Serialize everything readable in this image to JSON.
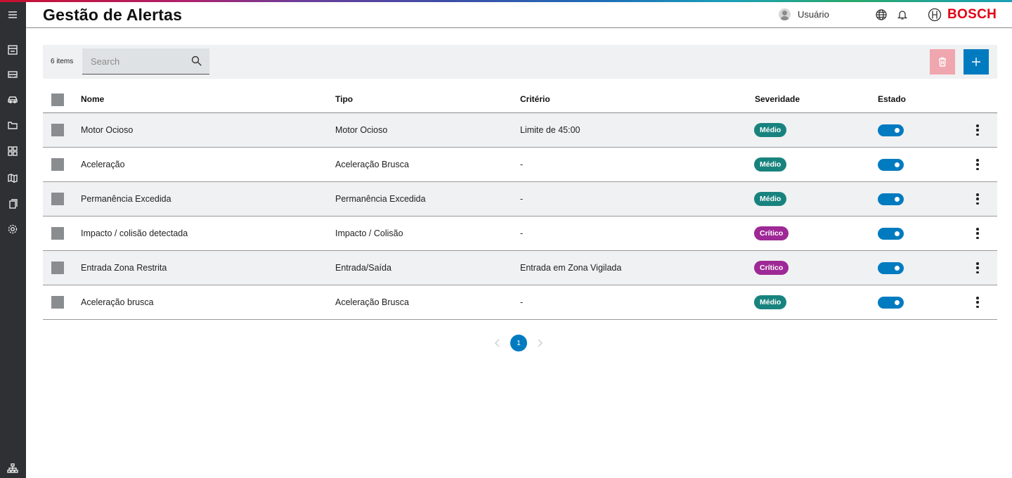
{
  "header": {
    "title": "Gestão de Alertas",
    "user_label": "Usuário",
    "brand": "BOSCH"
  },
  "sidebar": {
    "items": [
      {
        "icon": "menu-icon"
      },
      {
        "icon": "dashboard-icon"
      },
      {
        "icon": "vehicle-bus-icon"
      },
      {
        "icon": "car-icon"
      },
      {
        "icon": "folder-icon"
      },
      {
        "icon": "grid-icon"
      },
      {
        "icon": "map-icon"
      },
      {
        "icon": "documents-icon"
      },
      {
        "icon": "settings-icon"
      },
      {
        "icon": "hierarchy-icon"
      }
    ]
  },
  "toolbar": {
    "item_count": "6 items",
    "search_placeholder": "Search",
    "search_value": ""
  },
  "table": {
    "columns": [
      "Nome",
      "Tipo",
      "Critério",
      "Severidade",
      "Estado"
    ],
    "rows": [
      {
        "nome": "Motor Ocioso",
        "tipo": "Motor Ocioso",
        "criterio": "Limite de 45:00",
        "severidade": "Médio",
        "estado": true
      },
      {
        "nome": "Aceleração",
        "tipo": "Aceleração Brusca",
        "criterio": "-",
        "severidade": "Médio",
        "estado": true
      },
      {
        "nome": "Permanência Excedida",
        "tipo": "Permanência Excedida",
        "criterio": "-",
        "severidade": "Médio",
        "estado": true
      },
      {
        "nome": "Impacto / colisão detectada",
        "tipo": "Impacto / Colisão",
        "criterio": "-",
        "severidade": "Crítico",
        "estado": true
      },
      {
        "nome": "Entrada Zona Restrita",
        "tipo": "Entrada/Saída",
        "criterio": "Entrada em Zona Vigilada",
        "severidade": "Crítico",
        "estado": true
      },
      {
        "nome": "Aceleração brusca",
        "tipo": "Aceleração Brusca",
        "criterio": "-",
        "severidade": "Médio",
        "estado": true
      }
    ]
  },
  "pagination": {
    "current_page": "1"
  },
  "colors": {
    "accent": "#007bc0",
    "brand_red": "#e20015",
    "severity_medio": "#18837e",
    "severity_critico": "#9e2896",
    "delete_disabled": "#f0a6ae",
    "sidebar_bg": "#2e3033"
  }
}
